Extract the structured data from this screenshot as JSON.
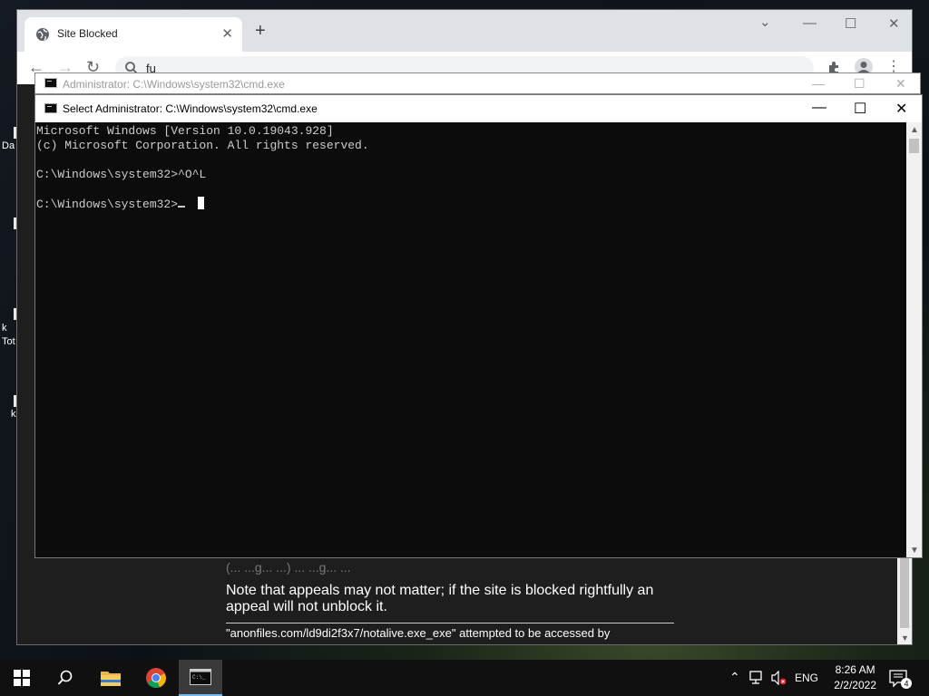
{
  "desktop": {
    "icons": [
      {
        "label": "Da"
      },
      {
        "label": ""
      },
      {
        "label": "k Tot"
      },
      {
        "label": "k"
      }
    ]
  },
  "browser": {
    "tab_title": "Site Blocked",
    "tab_close": "✕",
    "new_tab": "+",
    "omnibox_text": "fu",
    "window_controls": {
      "dropdown": "⌄",
      "minimize": "—",
      "maximize": "☐",
      "close": "✕"
    },
    "nav": {
      "back": "←",
      "forward": "→",
      "reload": "↻"
    }
  },
  "page": {
    "cut_off_text": "(... ...g... ...) ... ...g... ...",
    "appeal_note": "Note that appeals may not matter; if the site is blocked rightfully an appeal will not unblock it.",
    "access_line": "\"anonfiles.com/ld9di2f3x7/notalive.exe_exe\" attempted to be accessed by"
  },
  "cmd_back": {
    "title": "Administrator: C:\\Windows\\system32\\cmd.exe"
  },
  "cmd_front": {
    "title": "Select Administrator: C:\\Windows\\system32\\cmd.exe",
    "lines": [
      "Microsoft Windows [Version 10.0.19043.928]",
      "(c) Microsoft Corporation. All rights reserved.",
      "",
      "C:\\Windows\\system32>^O^L",
      ""
    ],
    "prompt": "C:\\Windows\\system32>"
  },
  "taskbar": {
    "apps": [
      "start",
      "search",
      "file-explorer",
      "chrome",
      "cmd"
    ],
    "language": "ENG",
    "time": "8:26 AM",
    "date": "2/2/2022",
    "notification_count": "4"
  }
}
